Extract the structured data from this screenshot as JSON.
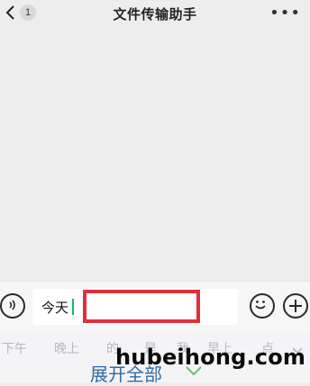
{
  "header": {
    "title": "文件传输助手",
    "unread_badge": "1",
    "more_label": "•••"
  },
  "input_bar": {
    "input_value": "今天"
  },
  "suggestions": [
    "下午",
    "晚上",
    "的",
    "是",
    "我",
    "早上",
    "点"
  ],
  "expand": {
    "label": "展开全部"
  },
  "watermark": "hubeihong.com",
  "colors": {
    "highlight": "#e0303a",
    "caret": "#07c160",
    "link": "#2f6aa8"
  }
}
